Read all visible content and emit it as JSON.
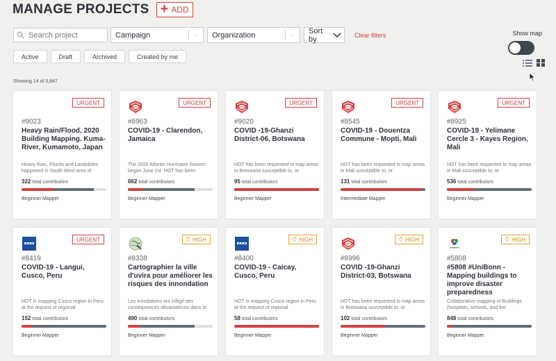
{
  "header": {
    "title": "MANAGE PROJECTS",
    "add_label": "ADD"
  },
  "filters": {
    "search_placeholder": "Search project",
    "campaign_label": "Campaign",
    "organization_label": "Organization",
    "sort_label": "Sort by",
    "clear_label": "Clear filters",
    "show_map_label": "Show map",
    "show_map_on": false
  },
  "status_tabs": [
    "Active",
    "Draft",
    "Archived",
    "Created by me"
  ],
  "showing_text": "Showing 14 of 3,847",
  "colors": {
    "accent": "#d73f3f",
    "high": "#e2a32b",
    "dark": "#2c3038",
    "bar_mapped": "#636b76"
  },
  "projects": [
    {
      "id": "#9023",
      "title": "Heavy Rain/Flood, 2020 Building Mapping. Kuma-River, Kumamoto, Japan",
      "description": "Heavy Rain, Floods and Landslides happened in South West area of",
      "contributors": "322",
      "contributors_label": "total contributors",
      "level": "Beginner Mapper",
      "priority": "URGENT",
      "priority_class": "urgent",
      "logo": "none",
      "mapped_pct": 85,
      "validated_pct": 38
    },
    {
      "id": "#8963",
      "title": "COVID-19 - Clarendon, Jamaica",
      "description": "The 2020 Atlantic Hurricane Season began June 1st. HOT has been",
      "contributors": "662",
      "contributors_label": "total contributors",
      "level": "Beginner Mapper",
      "priority": "URGENT",
      "priority_class": "urgent",
      "logo": "hot-logo",
      "mapped_pct": 79,
      "validated_pct": 17
    },
    {
      "id": "#9020",
      "title": "COVID -19-Ghanzi District-06, Botswana",
      "description": "HOT has been requested to map areas in Botswana susceptible to, or",
      "contributors": "95",
      "contributors_label": "total contributors",
      "level": "Beginner Mapper",
      "priority": "URGENT",
      "priority_class": "urgent",
      "logo": "hot-logo",
      "mapped_pct": 100,
      "validated_pct": 100
    },
    {
      "id": "#8545",
      "title": "COVID-19 - Douentza Commune - Mopti, Mali",
      "description": "HOT has been requested to map areas in Mali susceptible to, or",
      "contributors": "131",
      "contributors_label": "total contributors",
      "level": "Intermediate Mapper",
      "priority": "URGENT",
      "priority_class": "urgent",
      "logo": "hot-logo",
      "mapped_pct": 100,
      "validated_pct": 95
    },
    {
      "id": "#8925",
      "title": "COVID-19 - Yelimane Cercle 3 - Kayes Region, Mali",
      "description": "HOT has been requested to map areas in Mali susceptible to, or",
      "contributors": "536",
      "contributors_label": "total contributors",
      "level": "Beginner Mapper",
      "priority": "URGENT",
      "priority_class": "urgent",
      "logo": "hot-logo",
      "mapped_pct": 100,
      "validated_pct": 31
    },
    {
      "id": "#8419",
      "title": "COVID-19 - Langui, Cusco, Peru",
      "description": "HOT is mapping Cusco region in Peru at the request of regional",
      "contributors": "152",
      "contributors_label": "total contributors",
      "level": "Beginner Mapper",
      "priority": "URGENT",
      "priority_class": "urgent",
      "logo": "blue-logo",
      "mapped_pct": 100,
      "validated_pct": 12
    },
    {
      "id": "#8338",
      "title": "Cartographier la ville d'uvira pour améliorer les risques des innondation",
      "description": "Les inondations ont infligé des conséquences dévastatrices dans la",
      "contributors": "490",
      "contributors_label": "total contributors",
      "level": "Beginner Mapper",
      "priority": "HIGH",
      "priority_class": "high",
      "logo": "map-logo",
      "mapped_pct": 79,
      "validated_pct": 14
    },
    {
      "id": "#8400",
      "title": "COVID-19 - Caicay, Cusco, Peru",
      "description": "HOT is mapping Cusco region in Peru at the request of regional",
      "contributors": "58",
      "contributors_label": "total contributors",
      "level": "Beginner Mapper",
      "priority": "HIGH",
      "priority_class": "high",
      "logo": "blue-logo",
      "mapped_pct": 100,
      "validated_pct": 100
    },
    {
      "id": "#8996",
      "title": "COVID -19-Ghanzi District-03, Botswana",
      "description": "HOT has been requested to map areas in Botswana susceptible to, or",
      "contributors": "102",
      "contributors_label": "total contributors",
      "level": "Beginner Mapper",
      "priority": "HIGH",
      "priority_class": "high",
      "logo": "hot-logo",
      "mapped_pct": 100,
      "validated_pct": 52
    },
    {
      "id": "#5808",
      "title": "#5808 #UniBonn - Mapping buildings to improve disaster preparedness",
      "description": "Collaborative mapping of Buildings (hospitals, schools, and fire",
      "contributors": "848",
      "contributors_label": "total contributors",
      "level": "Beginner Mapper",
      "priority": "HIGH",
      "priority_class": "high",
      "logo": "flower-logo",
      "mapped_pct": 100,
      "validated_pct": 5
    }
  ]
}
